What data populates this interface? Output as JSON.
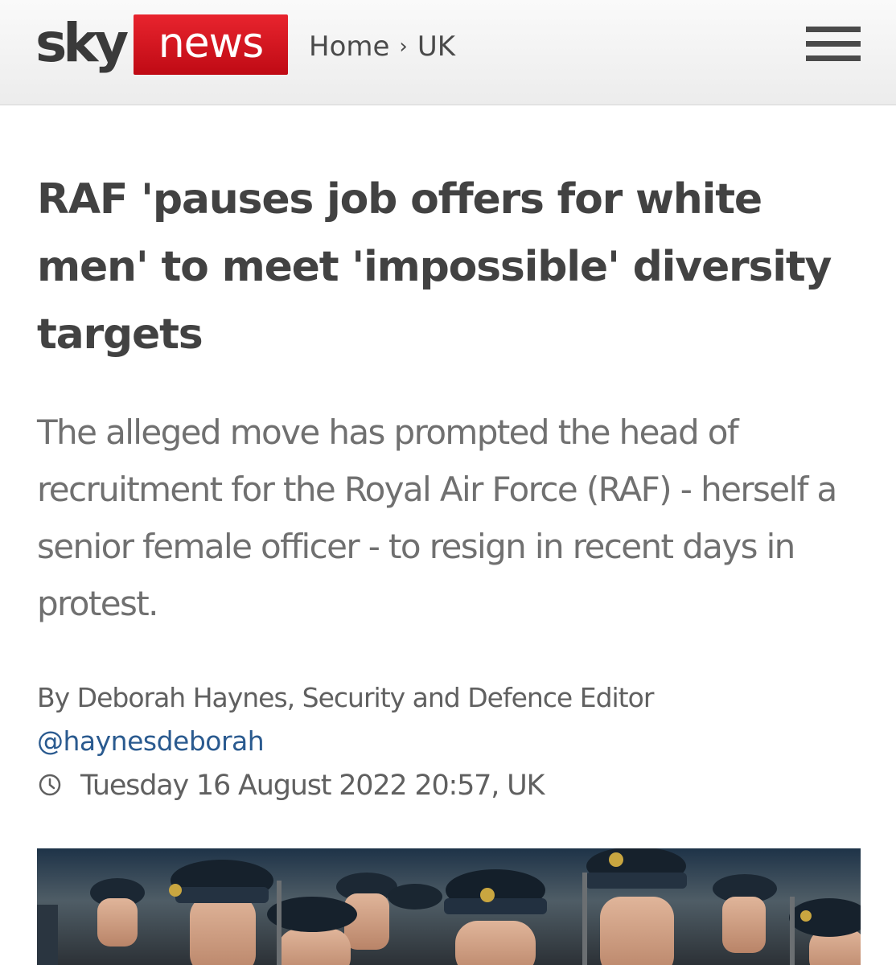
{
  "header": {
    "logo_sky": "sky",
    "logo_news": "news",
    "breadcrumb": {
      "home": "Home",
      "separator": "›",
      "section": "UK"
    },
    "menu_icon": "hamburger-menu-icon"
  },
  "article": {
    "headline": "RAF 'pauses job offers for white men' to meet 'impossible' diversity targets",
    "standfirst": "The alleged move has prompted the head of recruitment for the Royal Air Force (RAF) - herself a senior female officer - to resign in recent days in protest.",
    "byline": "By Deborah Haynes, Security and Defence Editor",
    "twitter_handle": "@haynesdeborah",
    "timestamp": "Tuesday 16 August 2022 20:57, UK",
    "timestamp_icon": "clock-icon",
    "hero_image": "photo of RAF personnel in uniform caps"
  },
  "colors": {
    "brand_red": "#d3121c",
    "text_dark": "#424242",
    "text_grey": "#707070",
    "link_blue": "#2a5a8f"
  }
}
